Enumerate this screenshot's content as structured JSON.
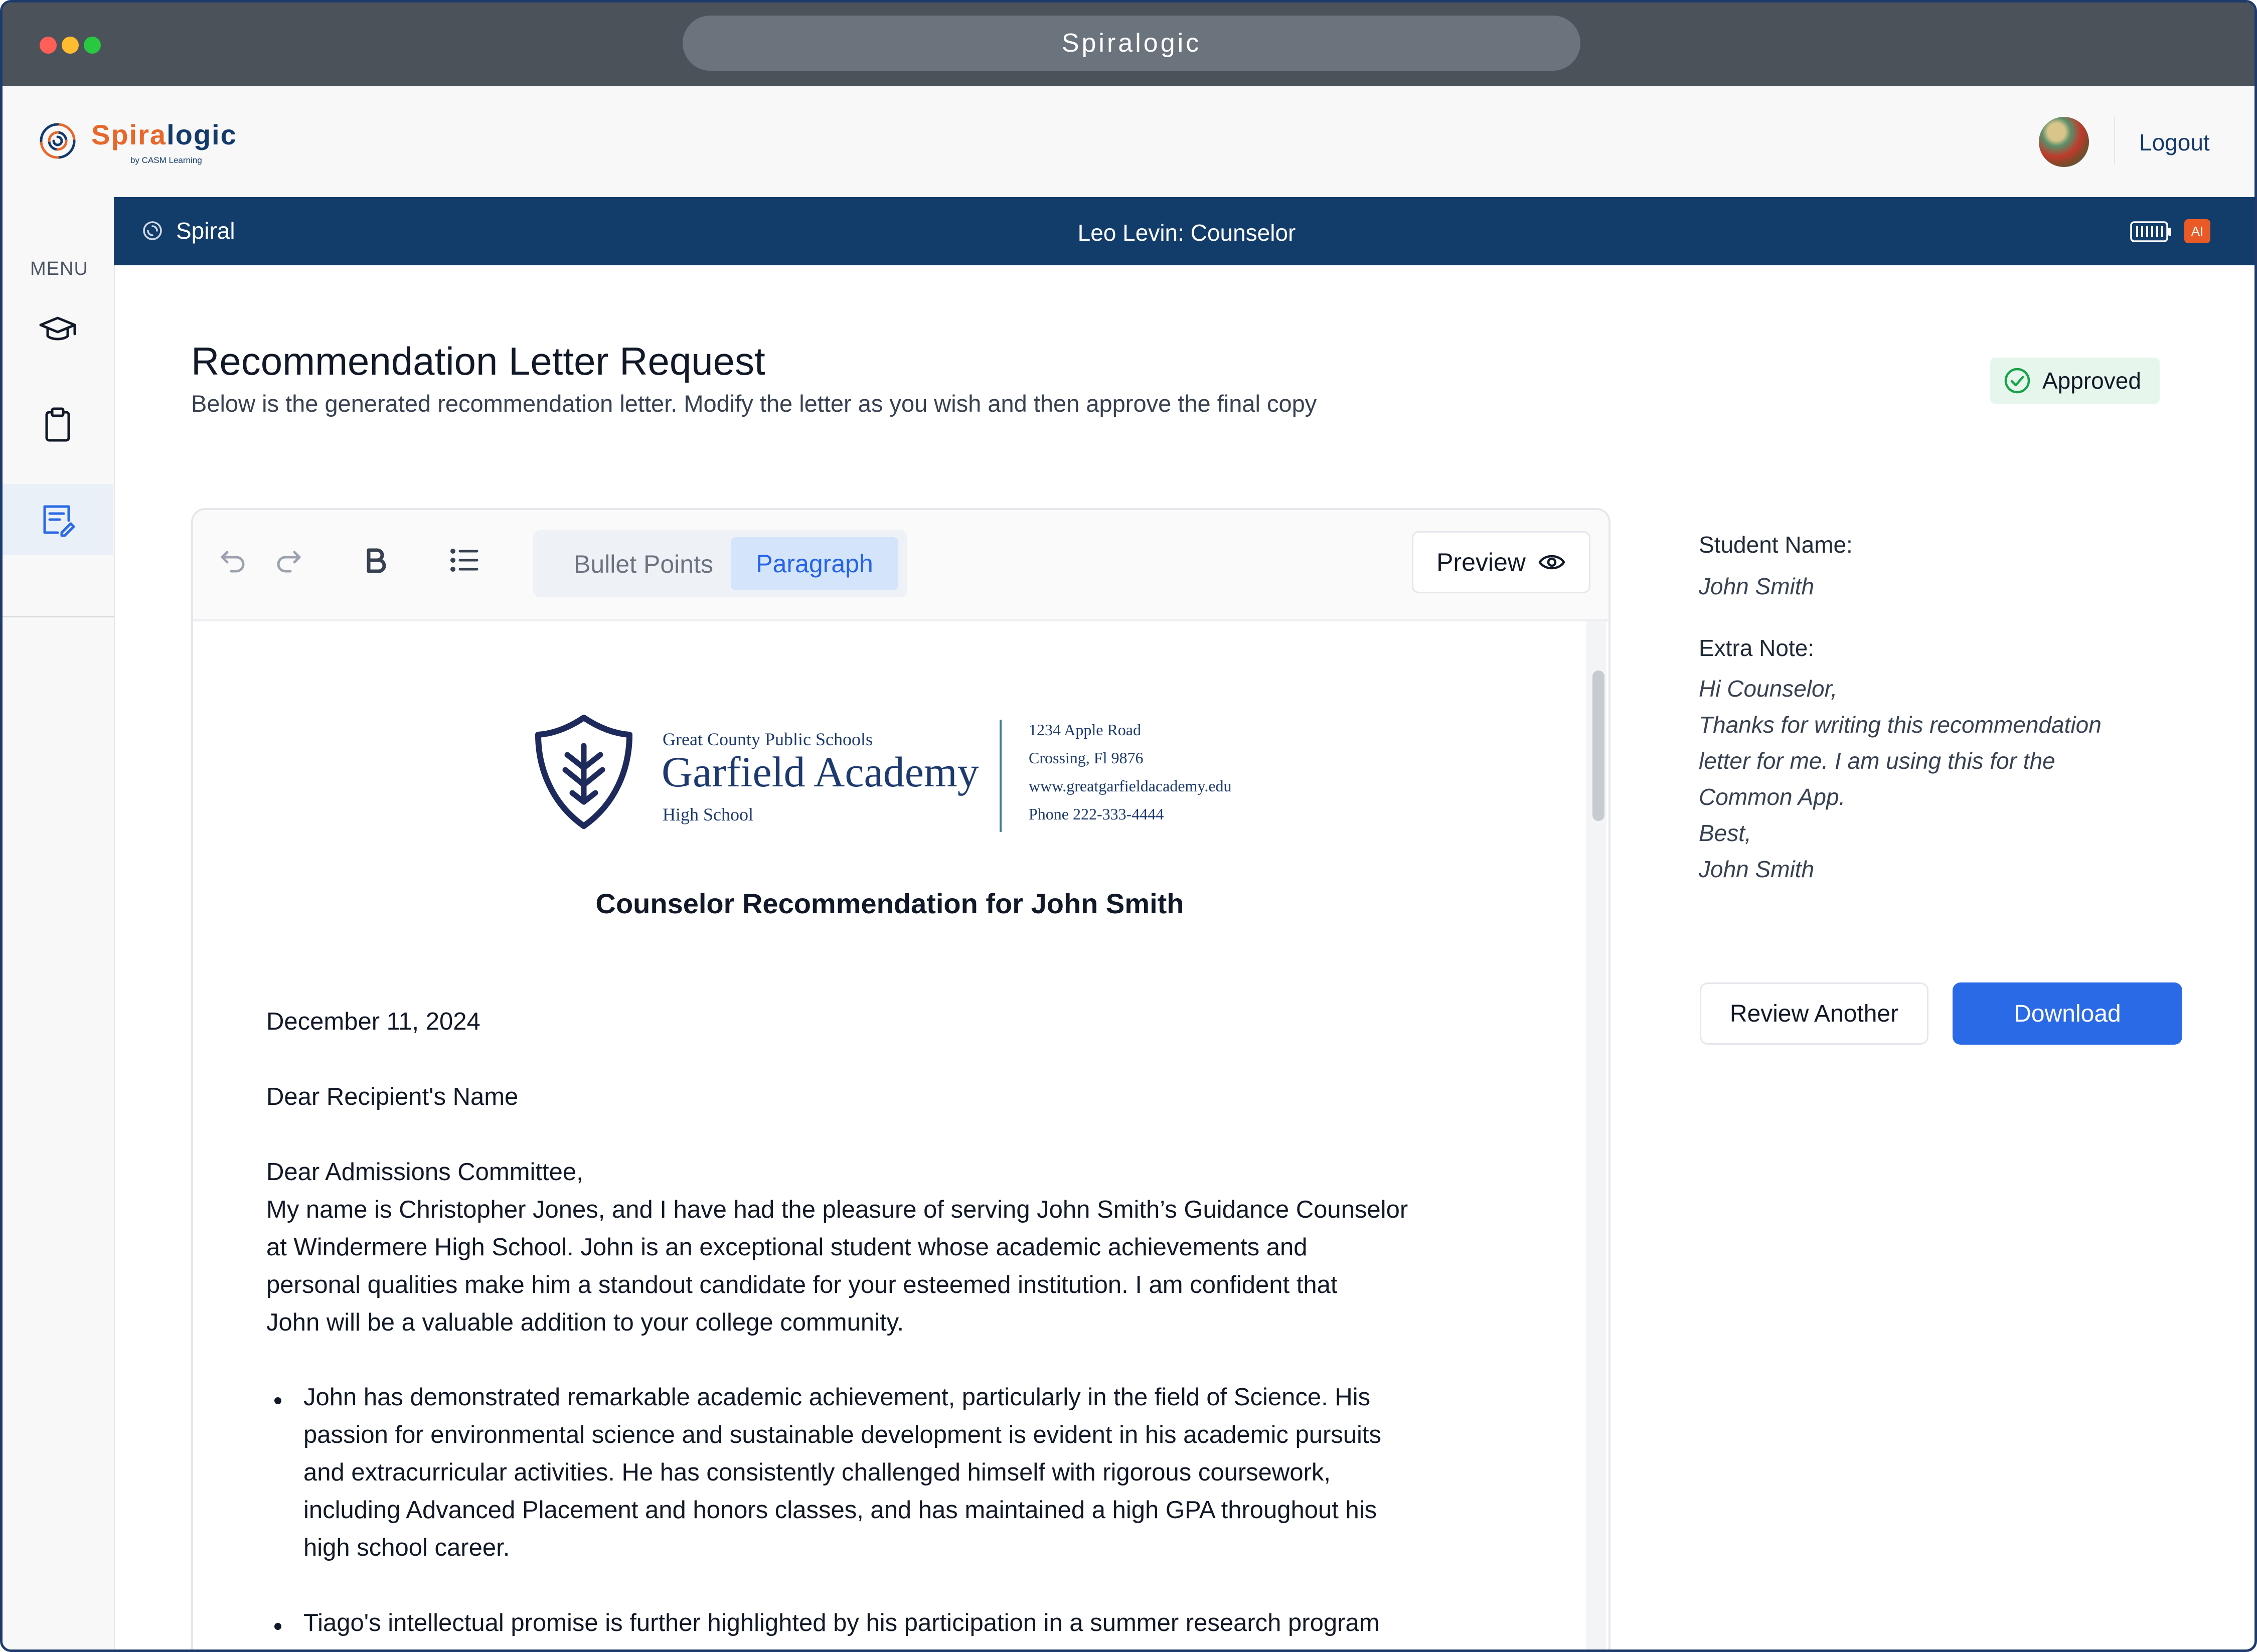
{
  "window": {
    "url_title": "Spiralogic",
    "traffic_lights": [
      "#ff5f57",
      "#febc2e",
      "#28c840"
    ]
  },
  "header": {
    "brand_part1": "Spira",
    "brand_part2": "logic",
    "brand_sub": "by CASM Learning",
    "logout": "Logout"
  },
  "sidebar": {
    "menu_label": "MENU",
    "items": [
      {
        "icon": "graduation-cap-icon",
        "active": false
      },
      {
        "icon": "clipboard-icon",
        "active": false
      },
      {
        "icon": "document-edit-icon",
        "active": true
      }
    ]
  },
  "bluebar": {
    "app_name": "Spiral",
    "user_role": "Leo Levin: Counselor",
    "ai_badge": "AI"
  },
  "main": {
    "title": "Recommendation Letter Request",
    "subtitle": "Below is the generated recommendation letter. Modify the letter as you wish and then approve the final copy",
    "status": "Approved"
  },
  "editor": {
    "tabs": {
      "bullet_points": "Bullet Points",
      "paragraph": "Paragraph",
      "selected": "Paragraph"
    },
    "preview_label": "Preview",
    "letterhead": {
      "district": "Great County Public Schools",
      "school": "Garfield Academy",
      "level": "High School",
      "address_lines": [
        "1234 Apple Road",
        "Crossing, Fl 9876",
        "www.greatgarfieldacademy.edu",
        "Phone 222-333-4444"
      ]
    },
    "letter": {
      "title": "Counselor Recommendation for John Smith",
      "date": "December 11, 2024",
      "recipient": "Dear Recipient's Name",
      "salutation": "Dear Admissions Committee,",
      "intro_lines": [
        "My name is Christopher Jones, and I have had the pleasure of serving John Smith’s Guidance Counselor",
        "at Windermere High School. John is an exceptional student whose academic achievements and",
        "personal qualities make him a standout candidate for your esteemed institution. I am confident that",
        "John will be a valuable addition to your college community."
      ],
      "bullet1_lines": [
        "John has demonstrated remarkable academic achievement, particularly in the field of Science. His",
        "passion for environmental science and sustainable development is evident in his academic pursuits",
        "and extracurricular activities. He has consistently challenged himself with rigorous coursework,",
        "including Advanced Placement and honors classes, and has maintained a high GPA throughout his",
        "high school career."
      ],
      "bullet2_lines": [
        "Tiago's intellectual promise is further highlighted by his participation in a summer research program"
      ]
    }
  },
  "panel": {
    "student_name_label": "Student Name:",
    "student_name": "John Smith",
    "extra_note_label": "Extra Note:",
    "extra_note_lines": [
      "Hi Counselor,",
      "Thanks for writing this recommendation",
      "letter for me. I am using this for the",
      "Common App.",
      "Best,",
      "John Smith"
    ],
    "review_another": "Review Another",
    "download": "Download"
  },
  "colors": {
    "brand_orange": "#e8672a",
    "brand_navy": "#143a6b",
    "header_bar": "#123d6b",
    "primary_button": "#2b6ae6",
    "approved_bg": "#e7f6ec",
    "approved_icon": "#16a34a"
  }
}
